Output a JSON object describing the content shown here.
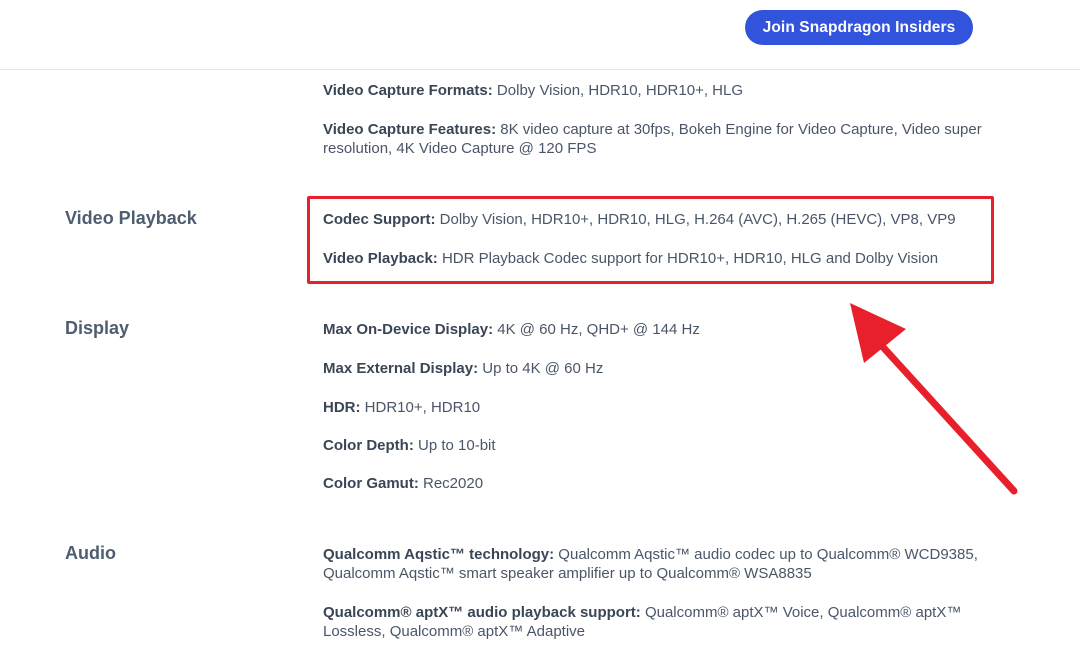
{
  "header": {
    "cta_label": "Join Snapdragon Insiders"
  },
  "sections": {
    "video_capture": {
      "formats_label": "Video Capture Formats:",
      "formats_value": " Dolby Vision, HDR10, HDR10+, HLG",
      "features_label": "Video Capture Features:",
      "features_value": " 8K video capture at 30fps, Bokeh Engine for Video Capture, Video super resolution, 4K Video Capture @ 120 FPS"
    },
    "video_playback": {
      "title": "Video Playback",
      "codec_label": "Codec Support:",
      "codec_value": " Dolby Vision, HDR10+, HDR10, HLG, H.264 (AVC), H.265 (HEVC), VP8, VP9",
      "playback_label": "Video Playback:",
      "playback_value": " HDR Playback Codec support for HDR10+, HDR10, HLG and Dolby Vision"
    },
    "display": {
      "title": "Display",
      "on_device_label": "Max On-Device Display:",
      "on_device_value": " 4K @ 60 Hz, QHD+ @ 144 Hz",
      "external_label": "Max External Display:",
      "external_value": " Up to 4K @ 60 Hz",
      "hdr_label": "HDR:",
      "hdr_value": " HDR10+, HDR10",
      "color_depth_label": "Color Depth:",
      "color_depth_value": " Up to 10-bit",
      "color_gamut_label": "Color Gamut:",
      "color_gamut_value": " Rec2020"
    },
    "audio": {
      "title": "Audio",
      "aqstic_label": "Qualcomm Aqstic™ technology:",
      "aqstic_value": " Qualcomm Aqstic™ audio codec up to Qualcomm® WCD9385, Qualcomm Aqstic™ smart speaker amplifier up to Qualcomm® WSA8835",
      "aptx_label": "Qualcomm® aptX™ audio playback support:",
      "aptx_value": " Qualcomm® aptX™ Voice, Qualcomm® aptX™ Lossless, Qualcomm® aptX™ Adaptive"
    }
  },
  "annotation": {
    "color": "#e8202b"
  }
}
